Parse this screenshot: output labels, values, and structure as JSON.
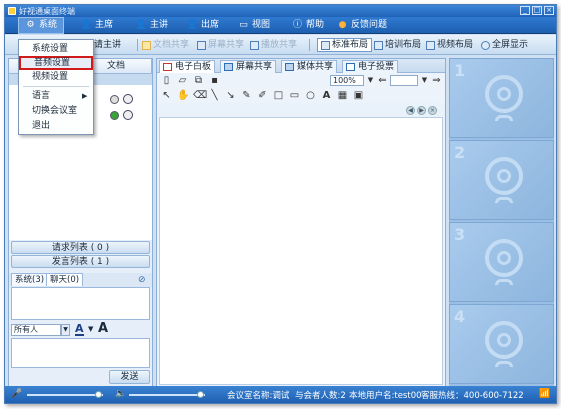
{
  "window": {
    "title": "好视通桌面终端"
  },
  "menubar": {
    "items": [
      {
        "label": "系统",
        "icon": "gear-icon"
      },
      {
        "label": "主席",
        "icon": "user-icon"
      },
      {
        "label": "主讲",
        "icon": "user-icon"
      },
      {
        "label": "出席",
        "icon": "user-icon"
      },
      {
        "label": "视图",
        "icon": "monitor-icon"
      },
      {
        "label": "帮助",
        "icon": "info-icon"
      },
      {
        "label": "反馈问题",
        "icon": "feedback-icon"
      }
    ]
  },
  "toolbar": {
    "request_speaker": "请主讲",
    "share_file": "文档共享",
    "share_screen": "屏幕共享",
    "share_media": "播放共享",
    "layout_standard": "标准布局",
    "layout_training": "培训布局",
    "layout_video": "视频布局",
    "fullscreen": "全屏显示"
  },
  "system_menu": {
    "items": [
      "系统设置",
      "音频设置",
      "视频设置",
      "语言",
      "切换会议室",
      "退出"
    ],
    "highlighted": "音频设置"
  },
  "left_panel": {
    "doc_tab": "文档",
    "request_list": "请求列表 ( 0 )",
    "speak_list": "发言列表 ( 1 )",
    "chat_tabs": [
      "系统(3)",
      "聊天(0)"
    ],
    "recipient": "所有人",
    "send": "发送",
    "font_letter": "A"
  },
  "center": {
    "tabs": [
      "电子白板",
      "屏幕共享",
      "媒体共享",
      "电子投票"
    ],
    "zoom": "100%"
  },
  "video_slots": [
    "1",
    "2",
    "3",
    "4"
  ],
  "statusbar": {
    "room": "会议室名称:调试",
    "participants": "与会者人数:2",
    "user": "本地用户名:test00",
    "hotline": "客服热线：400-600-7122"
  },
  "colors": {
    "titlebar": "#1f63b8",
    "menubar": "#2f7ad1",
    "highlight_border": "#d11a1a",
    "video_slot": "#9bbfe4"
  }
}
